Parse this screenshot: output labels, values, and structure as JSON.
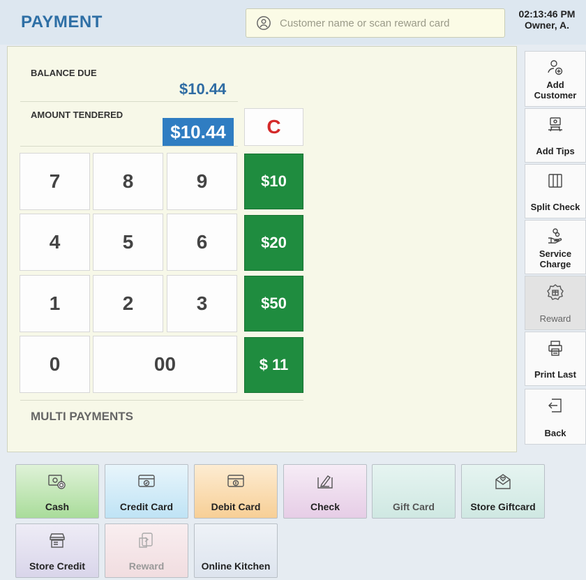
{
  "header": {
    "title": "PAYMENT",
    "search_placeholder": "Customer name or scan reward card",
    "time": "02:13:46 PM",
    "user": "Owner, A."
  },
  "main": {
    "balance_label": "BALANCE DUE",
    "balance_value": "$10.44",
    "tendered_label": "AMOUNT TENDERED",
    "tendered_value": "$10.44",
    "clear_label": "C",
    "keys": [
      "7",
      "8",
      "9",
      "4",
      "5",
      "6",
      "1",
      "2",
      "3",
      "0",
      "00"
    ],
    "quick_amounts": [
      "$10",
      "$20",
      "$50",
      "$ 11"
    ],
    "multi_label": "MULTI PAYMENTS"
  },
  "sidebar": {
    "items": [
      {
        "label": "Add Customer",
        "icon": "add-user-icon",
        "enabled": true
      },
      {
        "label": "Add Tips",
        "icon": "tip-money-icon",
        "enabled": true
      },
      {
        "label": "Split Check",
        "icon": "split-columns-icon",
        "enabled": true
      },
      {
        "label": "Service Charge",
        "icon": "hand-coins-icon",
        "enabled": true
      },
      {
        "label": "Reward",
        "icon": "gift-badge-icon",
        "enabled": false
      },
      {
        "label": "Print Last",
        "icon": "printer-icon",
        "enabled": true
      },
      {
        "label": "Back",
        "icon": "back-arrow-icon",
        "enabled": true
      }
    ]
  },
  "payments": {
    "row1": [
      {
        "label": "Cash",
        "icon": "cash-icon",
        "color": "#a9dc9a"
      },
      {
        "label": "Credit Card",
        "icon": "credit-card-icon",
        "color": "#bfe3f5"
      },
      {
        "label": "Debit Card",
        "icon": "debit-card-icon",
        "color": "#f7cf96"
      },
      {
        "label": "Check",
        "icon": "check-pen-icon",
        "color": "#e6cde6"
      },
      {
        "label": "Gift Card",
        "icon": "gift-card-icon",
        "color": "#cfe8e2"
      },
      {
        "label": "Store Giftcard",
        "icon": "store-giftcard-icon",
        "color": "#cfe8e2"
      }
    ],
    "row2": [
      {
        "label": "Store Credit",
        "icon": "store-credit-icon",
        "color": "#d9d5ea"
      },
      {
        "label": "Reward",
        "icon": "reward-icon",
        "color": "#f1dde0"
      },
      {
        "label": "Online Kitchen",
        "icon": "online-kitchen-icon",
        "color": "#dde4ee"
      }
    ]
  }
}
